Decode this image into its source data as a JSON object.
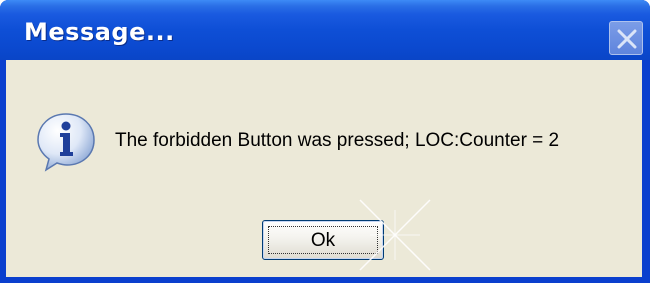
{
  "window": {
    "title": "Message...",
    "close_icon": "close-icon"
  },
  "dialog": {
    "icon": "info-icon",
    "message": "The forbidden Button was pressed; LOC:Counter = 2",
    "ok_label": "Ok"
  },
  "colors": {
    "titlebar": "#0b49cf",
    "client_background": "#ece9d8",
    "title_text": "#ffffff",
    "button_border": "#003c74"
  }
}
